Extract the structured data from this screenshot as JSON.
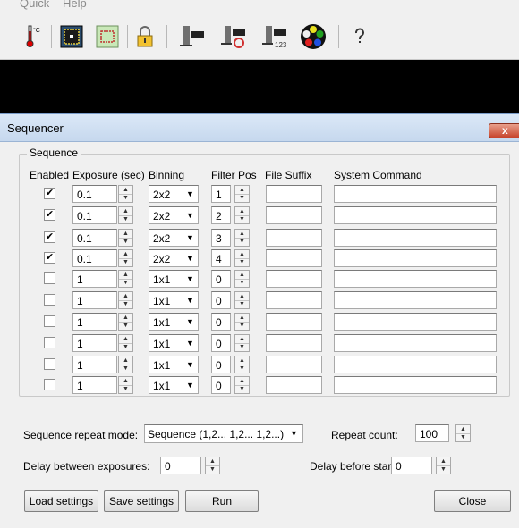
{
  "menu": {
    "quick": "Quick",
    "help": "Help"
  },
  "toolbar": {
    "icons": [
      "thermometer-icon",
      "frame-icon",
      "subframe-icon",
      "lock-icon",
      "filter-wheel-icon",
      "filter-refresh-icon",
      "filter-sequence-icon",
      "color-wheel-icon",
      "help-icon"
    ],
    "temp_unit": "°C",
    "seq_badge": "123"
  },
  "dialog": {
    "title": "Sequencer",
    "close_glyph": "x",
    "group_label": "Sequence",
    "headers": {
      "enabled": "Enabled",
      "exposure": "Exposure (sec)",
      "binning": "Binning",
      "filter_pos": "Filter Pos",
      "file_suffix": "File Suffix",
      "system_command": "System Command"
    },
    "rows": [
      {
        "check": "✔",
        "exposure": "0.1",
        "binning": "2x2",
        "filter": "1",
        "suffix": "",
        "command": ""
      },
      {
        "check": "✔",
        "exposure": "0.1",
        "binning": "2x2",
        "filter": "2",
        "suffix": "",
        "command": ""
      },
      {
        "check": "✔",
        "exposure": "0.1",
        "binning": "2x2",
        "filter": "3",
        "suffix": "",
        "command": ""
      },
      {
        "check": "✔",
        "exposure": "0.1",
        "binning": "2x2",
        "filter": "4",
        "suffix": "",
        "command": ""
      },
      {
        "check": "",
        "exposure": "1",
        "binning": "1x1",
        "filter": "0",
        "suffix": "",
        "command": ""
      },
      {
        "check": "",
        "exposure": "1",
        "binning": "1x1",
        "filter": "0",
        "suffix": "",
        "command": ""
      },
      {
        "check": "",
        "exposure": "1",
        "binning": "1x1",
        "filter": "0",
        "suffix": "",
        "command": ""
      },
      {
        "check": "",
        "exposure": "1",
        "binning": "1x1",
        "filter": "0",
        "suffix": "",
        "command": ""
      },
      {
        "check": "",
        "exposure": "1",
        "binning": "1x1",
        "filter": "0",
        "suffix": "",
        "command": ""
      },
      {
        "check": "",
        "exposure": "1",
        "binning": "1x1",
        "filter": "0",
        "suffix": "",
        "command": ""
      }
    ],
    "repeat_mode_label": "Sequence repeat mode:",
    "repeat_mode_value": "Sequence (1,2... 1,2... 1,2...)",
    "repeat_count_label": "Repeat count:",
    "repeat_count_value": "100",
    "delay_between_label": "Delay between exposures:",
    "delay_between_value": "0",
    "delay_start_label": "Delay before start:",
    "delay_start_value": "0",
    "buttons": {
      "load": "Load settings",
      "save": "Save settings",
      "run": "Run",
      "close": "Close"
    }
  }
}
